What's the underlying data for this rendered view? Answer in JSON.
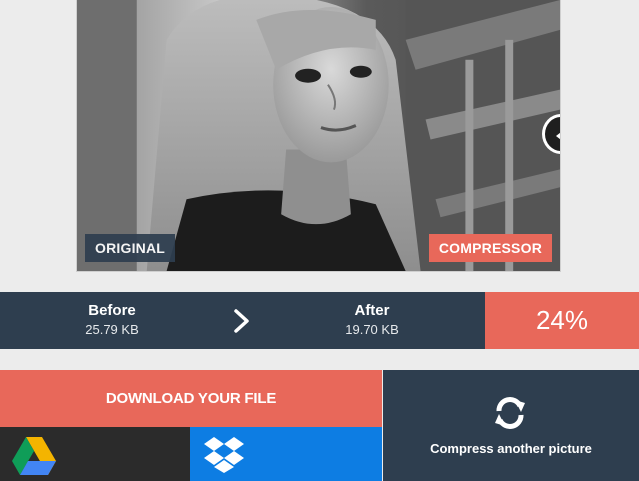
{
  "preview": {
    "label_original": "ORIGINAL",
    "label_compressed": "COMPRESSOR"
  },
  "stats": {
    "before_label": "Before",
    "before_value": "25.79 KB",
    "after_label": "After",
    "after_value": "19.70 KB",
    "reduction": "24%"
  },
  "actions": {
    "download_label": "DOWNLOAD YOUR FILE",
    "compress_another_label": "Compress another picture"
  },
  "icons": {
    "arrow": "chevron-right-icon",
    "gdrive": "google-drive-icon",
    "dropbox": "dropbox-icon",
    "refresh": "refresh-icon",
    "slider": "slider-handle-icon"
  },
  "colors": {
    "accent": "#e8685a",
    "dark": "#2e3e4f",
    "dropbox": "#0d7de3",
    "gdrive_bg": "#2b2b2b"
  }
}
